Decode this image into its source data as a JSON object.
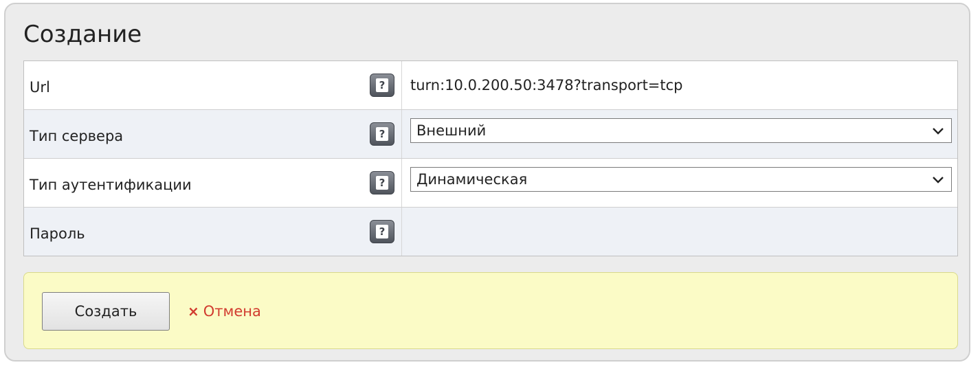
{
  "panel": {
    "title": "Создание"
  },
  "form": {
    "rows": [
      {
        "label": "Url",
        "help": "?",
        "value": "turn:10.0.200.50:3478?transport=tcp"
      },
      {
        "label": "Тип сервера",
        "help": "?",
        "value": "Внешний"
      },
      {
        "label": "Тип аутентификации",
        "help": "?",
        "value": "Динамическая"
      },
      {
        "label": "Пароль",
        "help": "?",
        "value": ""
      }
    ]
  },
  "actions": {
    "create_label": "Создать",
    "cancel_icon": "×",
    "cancel_label": "Отмена"
  },
  "colors": {
    "panel_bg": "#ececec",
    "row_alt_bg": "#eef1f6",
    "actions_bg": "#fbfbc6",
    "cancel_color": "#d13b2f"
  }
}
